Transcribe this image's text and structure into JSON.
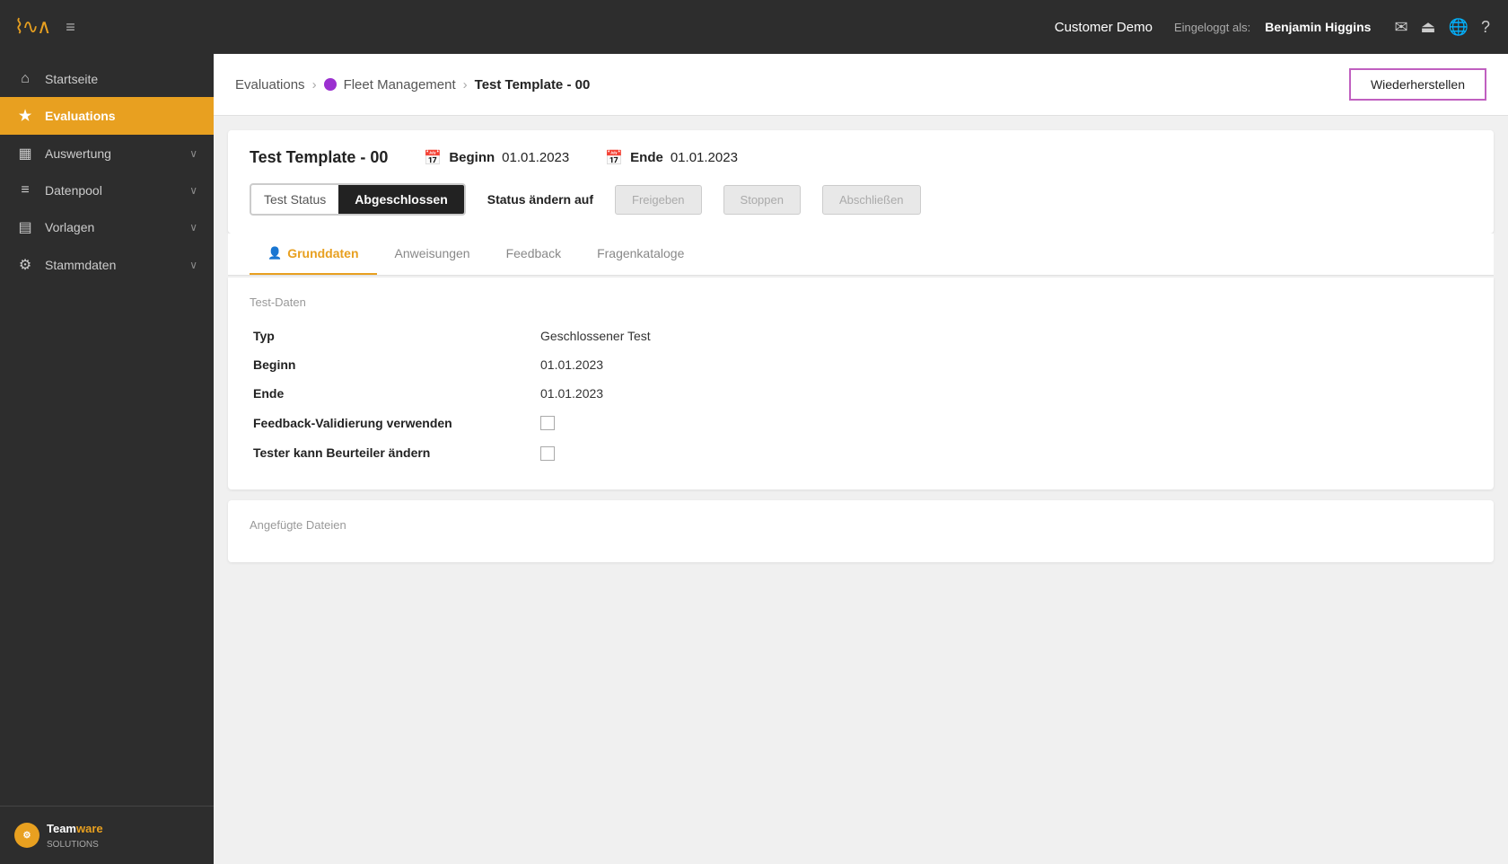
{
  "topbar": {
    "demo_label": "Customer Demo",
    "logged_as": "Eingeloggt als:",
    "user_name": "Benjamin Higgins",
    "icons": [
      "mail-icon",
      "logout-icon",
      "globe-icon",
      "help-icon"
    ]
  },
  "sidebar": {
    "logo_waves": "∿∿∿",
    "items": [
      {
        "id": "startseite",
        "label": "Startseite",
        "icon": "🏠",
        "active": false,
        "arrow": false
      },
      {
        "id": "evaluations",
        "label": "Evaluations",
        "icon": "⭐",
        "active": true,
        "arrow": false
      },
      {
        "id": "auswertung",
        "label": "Auswertung",
        "icon": "📊",
        "active": false,
        "arrow": true
      },
      {
        "id": "datenpool",
        "label": "Datenpool",
        "icon": "☰",
        "active": false,
        "arrow": true
      },
      {
        "id": "vorlagen",
        "label": "Vorlagen",
        "icon": "📋",
        "active": false,
        "arrow": true
      },
      {
        "id": "stammdaten",
        "label": "Stammdaten",
        "icon": "🔧",
        "active": false,
        "arrow": true
      }
    ],
    "footer_text": "Team",
    "footer_sub": "ware\nSOLUTIONS"
  },
  "breadcrumb": {
    "items": [
      {
        "label": "Evaluations",
        "type": "link"
      },
      {
        "label": "Fleet Management",
        "type": "dot-link"
      },
      {
        "label": "Test Template - 00",
        "type": "current"
      }
    ],
    "restore_button": "Wiederherstellen"
  },
  "page_header": {
    "title": "Test Template - 00",
    "begin_label": "Beginn",
    "begin_value": "01.01.2023",
    "end_label": "Ende",
    "end_value": "01.01.2023"
  },
  "status": {
    "test_status_label": "Test Status",
    "test_status_value": "Abgeschlossen",
    "change_label": "Status ändern auf",
    "buttons": [
      {
        "label": "Freigeben",
        "disabled": true
      },
      {
        "label": "Stoppen",
        "disabled": true
      },
      {
        "label": "Abschließen",
        "disabled": true
      }
    ]
  },
  "tabs": [
    {
      "label": "Grunddaten",
      "icon": "👤",
      "active": true
    },
    {
      "label": "Anweisungen",
      "icon": "",
      "active": false
    },
    {
      "label": "Feedback",
      "icon": "",
      "active": false
    },
    {
      "label": "Fragenkataloge",
      "icon": "",
      "active": false
    }
  ],
  "test_data": {
    "section_title": "Test-Daten",
    "rows": [
      {
        "label": "Typ",
        "value": "Geschlossener Test",
        "type": "text"
      },
      {
        "label": "Beginn",
        "value": "01.01.2023",
        "type": "text"
      },
      {
        "label": "Ende",
        "value": "01.01.2023",
        "type": "text"
      },
      {
        "label": "Feedback-Validierung verwenden",
        "value": "",
        "type": "checkbox"
      },
      {
        "label": "Tester kann Beurteiler ändern",
        "value": "",
        "type": "checkbox"
      }
    ]
  },
  "attached_files": {
    "section_title": "Angefügte Dateien"
  }
}
